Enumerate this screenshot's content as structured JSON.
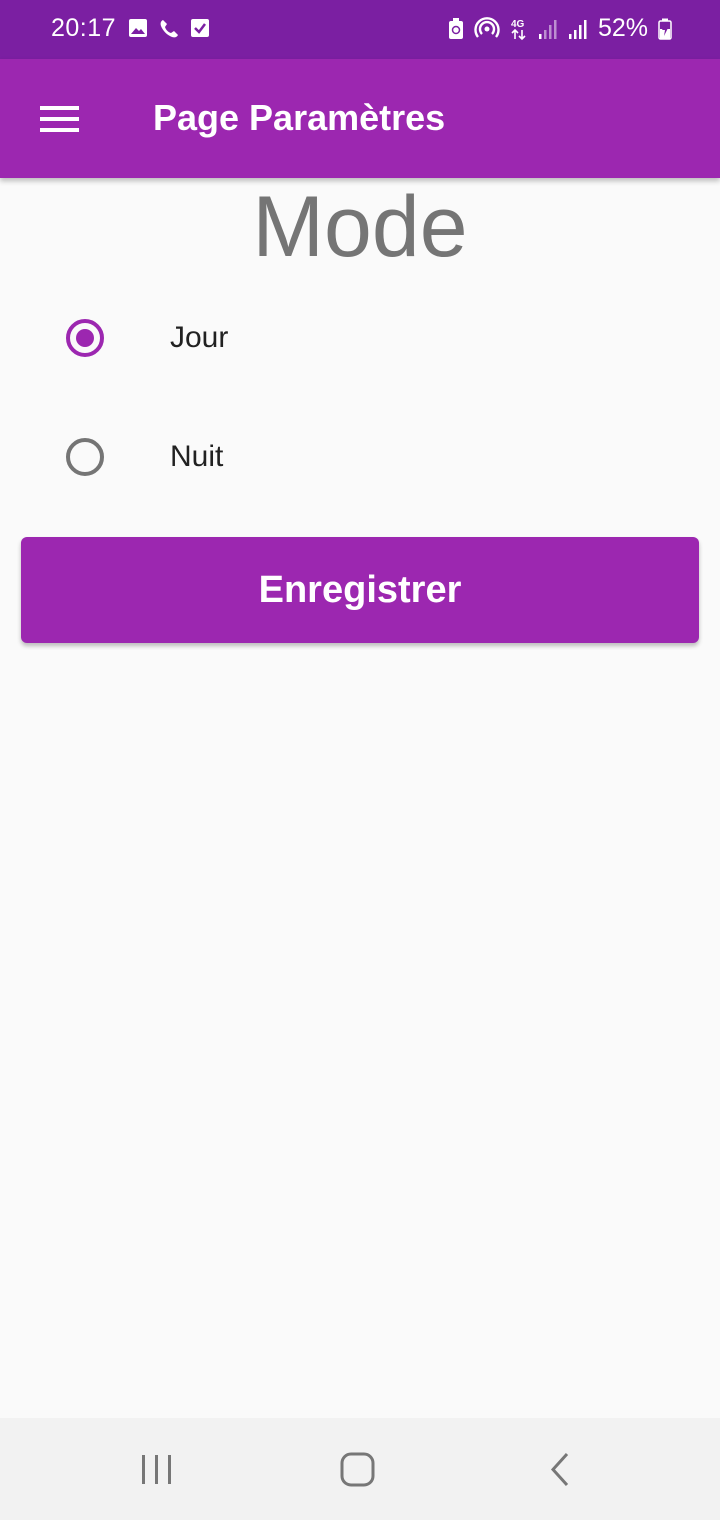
{
  "status_bar": {
    "time": "20:17",
    "battery": "52%",
    "network": "4G",
    "left_icons": [
      "image-icon",
      "phone-icon",
      "checkbox-icon"
    ],
    "right_icons": [
      "battery-saver-icon",
      "hotspot-icon",
      "network-4g-icon",
      "signal-icon",
      "signal-icon",
      "battery-charging-icon"
    ]
  },
  "app_bar": {
    "title": "Page Paramètres",
    "menu_icon": "hamburger-menu-icon"
  },
  "content": {
    "heading": "Mode",
    "options": [
      {
        "label": "Jour",
        "selected": true
      },
      {
        "label": "Nuit",
        "selected": false
      }
    ],
    "save_label": "Enregistrer"
  },
  "nav_bar": {
    "buttons": [
      "recents-icon",
      "home-icon",
      "back-icon"
    ]
  },
  "colors": {
    "primary": "#9c27b0",
    "primary_dark": "#7b1fa2",
    "heading_text": "#757575",
    "radio_unselected": "#757575",
    "background": "#fafafa"
  }
}
